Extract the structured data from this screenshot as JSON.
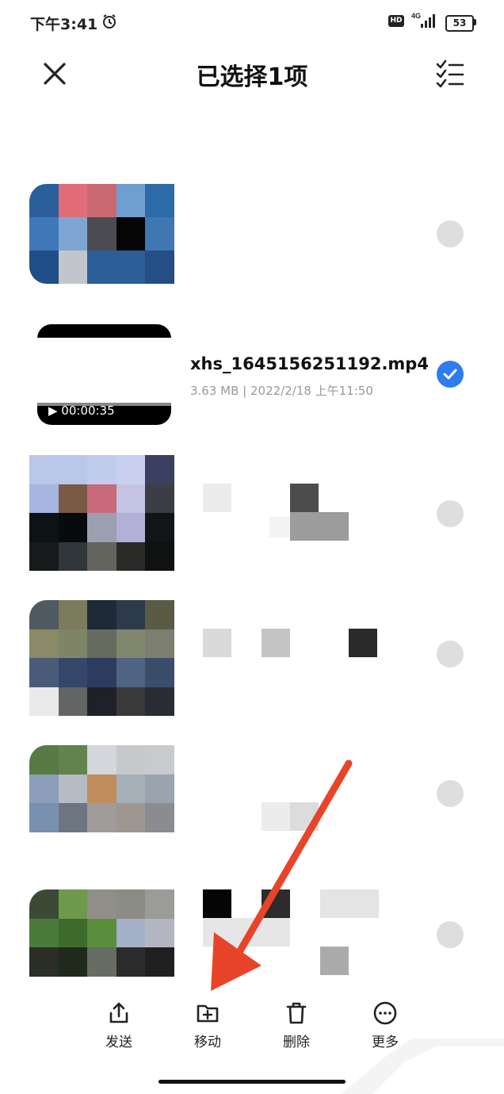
{
  "status_bar": {
    "time": "下午3:41",
    "hd": "HD",
    "network": "4G",
    "battery": "53"
  },
  "header": {
    "title": "已选择1项",
    "close_icon": "close-icon",
    "select_all_icon": "checklist-icon"
  },
  "list": {
    "selected_item": {
      "file_name": "xhs_1645156251192.mp4",
      "meta": "3.63 MB | 2022/2/18 上午11:50",
      "duration": "▶ 00:00:35",
      "checked": true
    },
    "rows_checked": [
      false,
      true,
      false,
      false,
      false,
      false
    ]
  },
  "toolbar": {
    "items": [
      {
        "label": "发送",
        "icon": "share-icon"
      },
      {
        "label": "移动",
        "icon": "folder-move-icon"
      },
      {
        "label": "删除",
        "icon": "trash-icon"
      },
      {
        "label": "更多",
        "icon": "more-icon"
      }
    ]
  },
  "colors": {
    "accent": "#2f7bf0",
    "radio_unchecked": "#dedede",
    "annotation_arrow": "#e8442a"
  }
}
